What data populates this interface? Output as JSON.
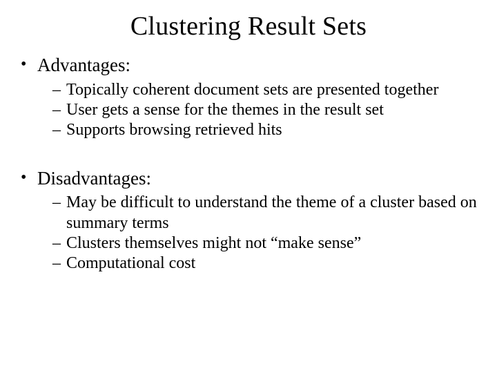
{
  "title": "Clustering Result Sets",
  "sections": [
    {
      "heading": "Advantages:",
      "items": [
        "Topically coherent document sets are presented together",
        "User gets a sense for the themes in the result set",
        "Supports browsing retrieved hits"
      ]
    },
    {
      "heading": "Disadvantages:",
      "items": [
        "May be difficult to understand the theme of a cluster based on summary terms",
        "Clusters themselves might not “make sense”",
        "Computational cost"
      ]
    }
  ]
}
